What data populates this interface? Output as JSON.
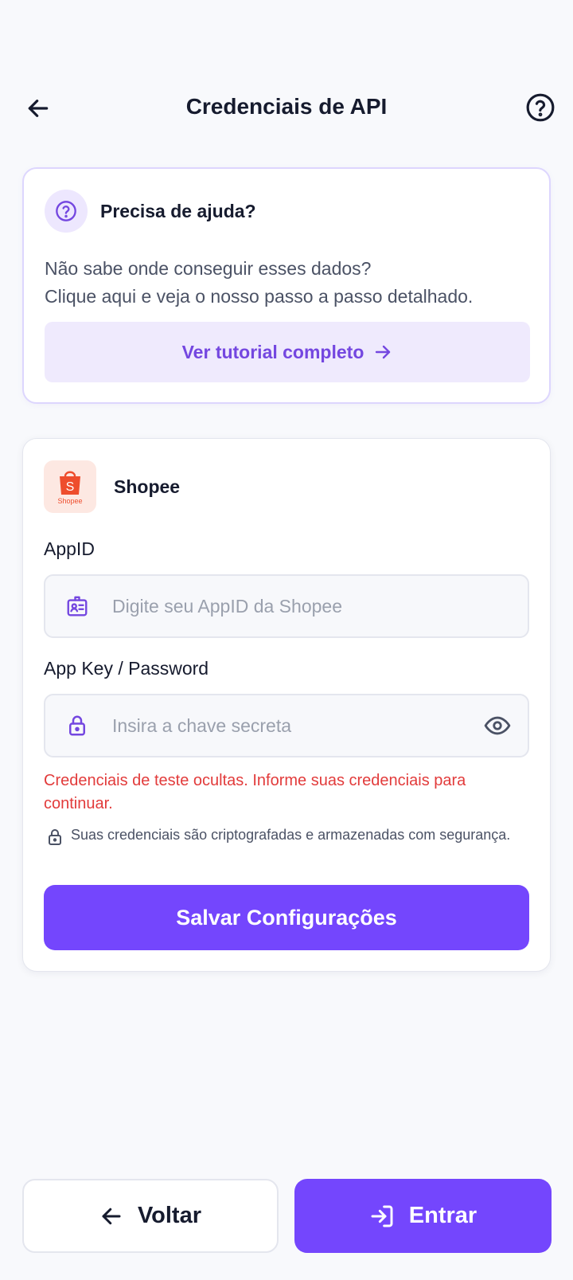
{
  "header": {
    "title": "Credenciais de API",
    "back_icon": "arrow-left-icon",
    "help_icon": "question-circle-icon"
  },
  "help_card": {
    "icon": "question-circle-icon",
    "title": "Precisa de ajuda?",
    "line1": "Não sabe onde conseguir esses dados?",
    "line2": "Clique aqui e veja o nosso passo a passo detalhado.",
    "button_label": "Ver tutorial completo",
    "button_icon": "arrow-right-icon"
  },
  "form": {
    "platform_name": "Shopee",
    "platform_logo_text": "Shopee",
    "appid": {
      "label": "AppID",
      "placeholder": "Digite seu AppID da Shopee",
      "value": "",
      "icon": "id-badge-icon"
    },
    "appkey": {
      "label": "App Key / Password",
      "placeholder": "Insira a chave secreta",
      "value": "",
      "icon": "lock-icon",
      "toggle_icon": "eye-icon"
    },
    "error": "Credenciais de teste ocultas. Informe suas credenciais para continuar.",
    "security_note": "Suas credenciais são criptografadas e armazenadas com segurança.",
    "save_label": "Salvar Configurações"
  },
  "footer": {
    "back_label": "Voltar",
    "enter_label": "Entrar"
  },
  "colors": {
    "accent": "#7446fd",
    "accent_light": "#efeafd",
    "error": "#e23b3b",
    "shopee": "#ee4d2d",
    "background": "#f8f9fc"
  }
}
